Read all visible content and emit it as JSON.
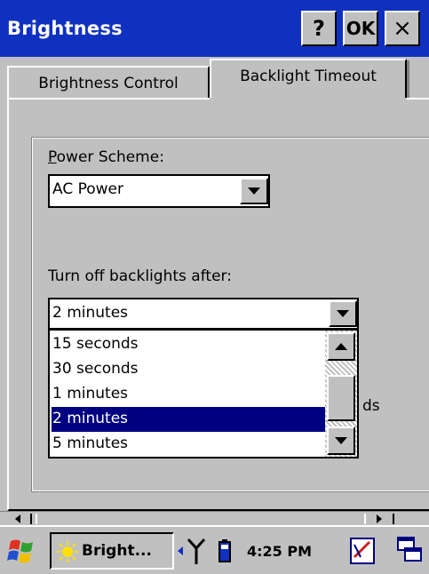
{
  "window": {
    "title": "Brightness",
    "help_label": "?",
    "ok_label": "OK",
    "close_label": "×"
  },
  "tabs": [
    {
      "label": "Brightness Control",
      "active": false
    },
    {
      "label": "Backlight Timeout",
      "active": true
    }
  ],
  "power_scheme": {
    "label": "Power Scheme:",
    "value": "AC Power"
  },
  "turn_off": {
    "label": "Turn off backlights after:",
    "value": "2 minutes",
    "options": [
      "15 seconds",
      "30 seconds",
      "1 minutes",
      "2 minutes",
      "5 minutes"
    ],
    "selected": "2 minutes"
  },
  "partial_text": "ds",
  "taskbar": {
    "task_label": "Bright...",
    "time": "4:25 PM"
  },
  "icons": {
    "start": "windows-flag-icon",
    "task": "sun-icon",
    "signal": "antenna-icon",
    "battery": "battery-icon",
    "input": "pen-input-icon",
    "desktop": "desktop-icon"
  },
  "colors": {
    "titlebar": "#1030c0",
    "selection": "#000080",
    "face": "#c0c0c0"
  }
}
